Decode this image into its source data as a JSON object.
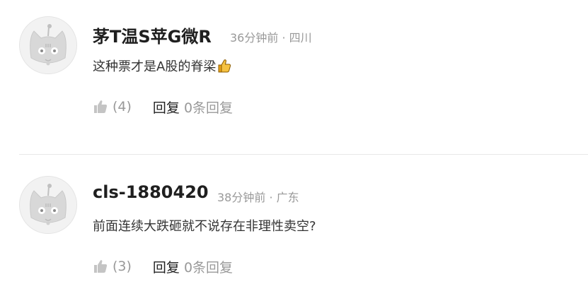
{
  "comments": [
    {
      "username": "茅T温S苹G微R",
      "meta": "36分钟前 · 四川",
      "text": "这种票才是A股的脊梁",
      "emoji": "thumbs-up-emoji",
      "like_count": "(4)",
      "reply_label": "回复",
      "reply_count": "0条回复"
    },
    {
      "username": "cls-1880420",
      "meta": "38分钟前 · 广东",
      "text": "前面连续大跌砸就不说存在非理性卖空?",
      "like_count": "(3)",
      "reply_label": "回复",
      "reply_count": "0条回复"
    }
  ],
  "icons": {
    "avatar": "cat-avatar-icon",
    "like": "thumbs-up-icon"
  },
  "colors": {
    "username": "#1f1f1f",
    "meta": "#999999",
    "like_icon": "#c4c4c4",
    "divider": "#e8e8e8"
  }
}
